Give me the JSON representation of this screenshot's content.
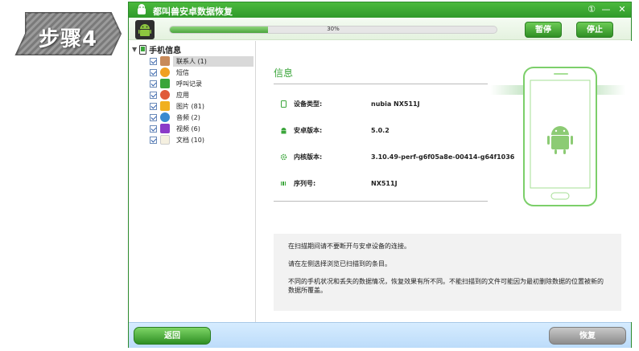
{
  "step_badge": {
    "label": "步骤4"
  },
  "window": {
    "title": "都叫兽安卓数据恢复",
    "controls": [
      "①",
      "—",
      "✕"
    ]
  },
  "toolbar": {
    "progress": 0.3,
    "progress_label": "30%",
    "pause_label": "暂停",
    "stop_label": "停止"
  },
  "sidebar": {
    "root_label": "手机信息",
    "items": [
      {
        "label": "联系人 (1)",
        "icon": "contacts-icon",
        "color": "#c88a5a",
        "selected": true
      },
      {
        "label": "短信",
        "icon": "sms-icon",
        "color": "#f0a020"
      },
      {
        "label": "呼叫记录",
        "icon": "call-log-icon",
        "color": "#3aa53a"
      },
      {
        "label": "应用",
        "icon": "apps-icon",
        "color": "#e05a3a"
      },
      {
        "label": "图片 (81)",
        "icon": "photos-icon",
        "color": "#f0b020"
      },
      {
        "label": "音频 (2)",
        "icon": "audio-icon",
        "color": "#3a8ad0"
      },
      {
        "label": "视频 (6)",
        "icon": "video-icon",
        "color": "#8a3ac8"
      },
      {
        "label": "文档 (10)",
        "icon": "documents-icon",
        "color": "#f5f0e0"
      }
    ]
  },
  "info": {
    "title": "信息",
    "rows": [
      {
        "key": "设备类型:",
        "value": "nubia NX511J",
        "icon": "device-icon"
      },
      {
        "key": "安卓版本:",
        "value": "5.0.2",
        "icon": "android-icon"
      },
      {
        "key": "内核版本:",
        "value": "3.10.49-perf-g6f05a8e-00414-g64f1036",
        "icon": "gear-icon"
      },
      {
        "key": "序列号:",
        "value": "NX511J",
        "icon": "barcode-icon"
      }
    ]
  },
  "notes": [
    "在扫描期间请不要断开与安卓设备的连接。",
    "请在左侧选择浏览已扫描到的条目。",
    "不同的手机状况和丢失的数据情况，恢复效果有所不同。不能扫描到的文件可能因为最初删除数据的位置被新的数据所覆盖。"
  ],
  "footer": {
    "back_label": "返回",
    "recover_label": "恢复"
  },
  "colors": {
    "brand_green": "#3aa53a",
    "title_bar": "#2f9a2a",
    "footer_blue": "#c8e2fb"
  }
}
